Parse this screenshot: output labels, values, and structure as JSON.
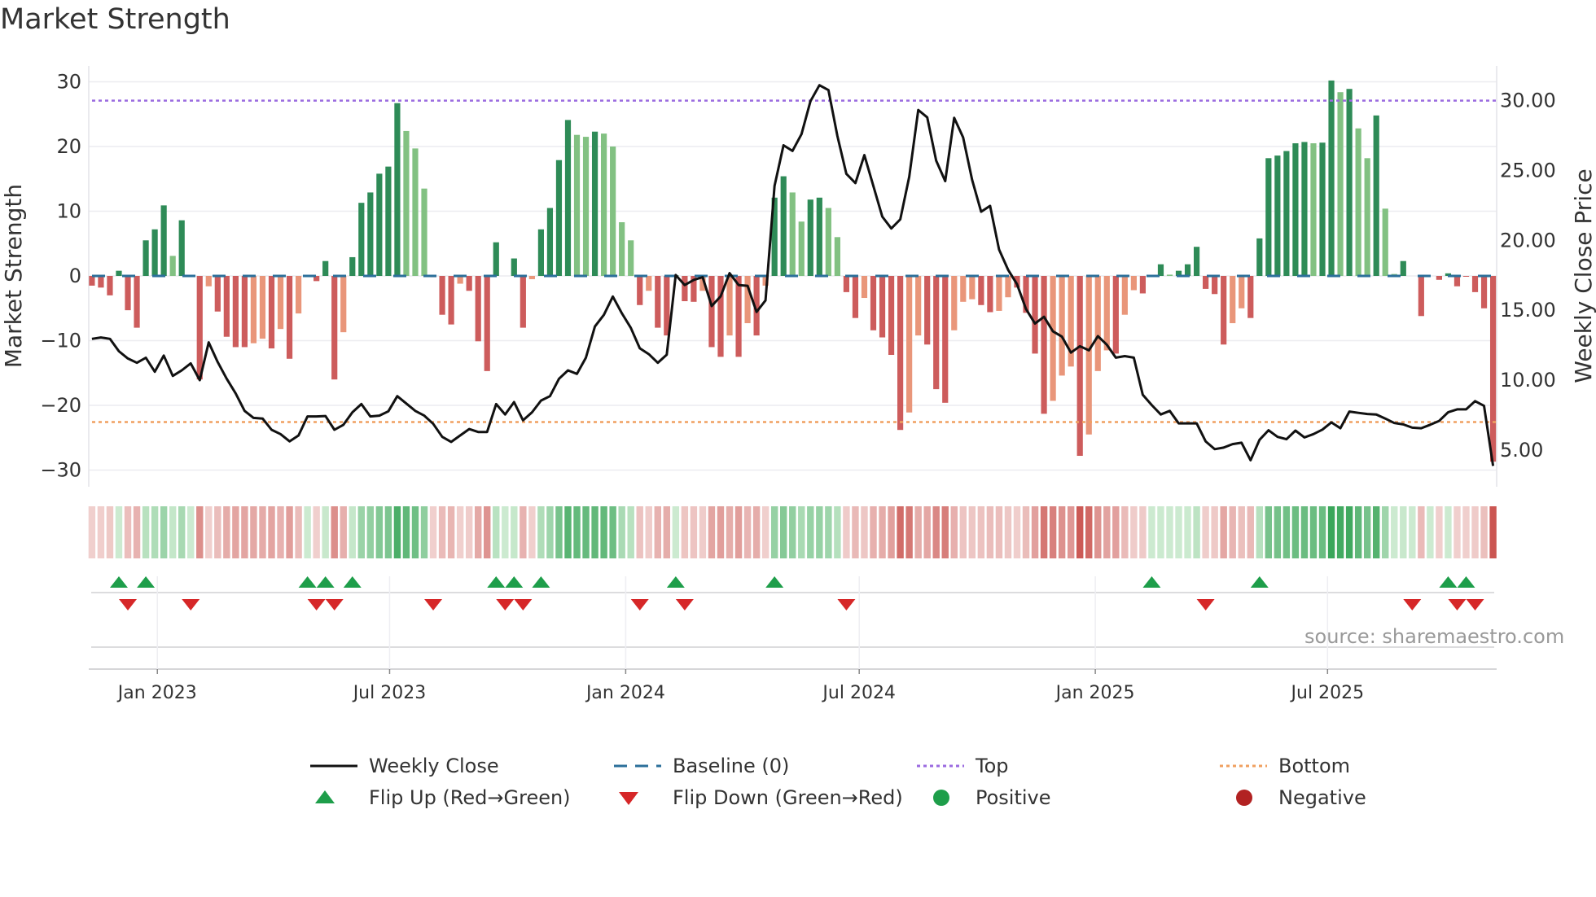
{
  "title": "Market Strength",
  "source": "source: sharemaestro.com",
  "legend": {
    "weekly_close": "Weekly Close",
    "baseline": "Baseline (0)",
    "top": "Top",
    "bottom": "Bottom",
    "flip_up": "Flip Up (Red→Green)",
    "flip_down": "Flip Down (Green→Red)",
    "positive": "Positive",
    "negative": "Negative"
  },
  "colors": {
    "strong_positive": "#2e8b57",
    "weak_positive": "#82c182",
    "strong_negative": "#cd5c5c",
    "weak_negative": "#e9967a",
    "baseline": "#2b6f9a",
    "top": "#9b6be0",
    "bottom": "#f0a060",
    "close": "#111111",
    "flip_up": "#1e9e4a",
    "flip_down": "#d62728",
    "positive": "#1e9e4a",
    "negative": "#b22222"
  },
  "chart_data": {
    "type": "bar+line",
    "title": "Market Strength",
    "start_week": "2022-11-11",
    "y_left": {
      "label": "Market Strength",
      "range": [
        -32.6,
        32.5
      ],
      "ticks": [
        30,
        20,
        10,
        0,
        -10,
        -20,
        -30
      ],
      "tick_labels": [
        "30",
        "20",
        "10",
        "0",
        "−10",
        "−20",
        "−30"
      ]
    },
    "y_right": {
      "label": "Weekly Close Price",
      "ticks": [
        30,
        25,
        20,
        15,
        10,
        5
      ],
      "tick_labels": [
        "30.00",
        "25.00",
        "20.00",
        "15.00",
        "10.00",
        "5.00"
      ]
    },
    "x_ticks": [
      {
        "label": "Jan 2023",
        "date": "2023-01-01"
      },
      {
        "label": "Jul 2023",
        "date": "2023-07-01"
      },
      {
        "label": "Jan 2024",
        "date": "2024-01-01"
      },
      {
        "label": "Jul 2024",
        "date": "2024-07-01"
      },
      {
        "label": "Jan 2025",
        "date": "2025-01-01"
      },
      {
        "label": "Jul 2025",
        "date": "2025-07-01"
      }
    ],
    "top_level_price": 30,
    "bottom_level_price": 7,
    "strength": [
      -1.5,
      -1.8,
      -3,
      0.8,
      -5.3,
      -8,
      5.5,
      7.2,
      10.9,
      3.1,
      8.6,
      0,
      -16,
      -1.6,
      -5.5,
      -9.4,
      -11,
      -11,
      -10.4,
      -9.7,
      -11.2,
      -8.2,
      -12.8,
      -5.8,
      0,
      -0.8,
      2.3,
      -16,
      -8.7,
      2.9,
      11.3,
      12.9,
      15.8,
      16.9,
      26.7,
      22.4,
      19.7,
      13.5,
      -0.2,
      -6,
      -7.5,
      -1.2,
      -2.3,
      -10.1,
      -14.7,
      5.2,
      0,
      2.7,
      -8,
      -0.5,
      7.2,
      10.5,
      17.9,
      24.1,
      21.8,
      21.5,
      22.3,
      22,
      20,
      8.3,
      5.5,
      -4.5,
      -2.3,
      -8,
      -9.2,
      0.1,
      -3.9,
      -4,
      -2.3,
      -11,
      -12.5,
      -9.2,
      -12.5,
      -7.3,
      -9.2,
      -1.5,
      12.1,
      15.4,
      12.9,
      8.4,
      11.8,
      12.1,
      10.5,
      6,
      -2.5,
      -6.5,
      -3.4,
      -8.4,
      -9.5,
      -12.2,
      -23.8,
      -21.1,
      -9.2,
      -10.6,
      -17.5,
      -19.6,
      -8.4,
      -4,
      -3.6,
      -4.5,
      -5.6,
      -5.4,
      -3.3,
      -1.8,
      -5.7,
      -12,
      -21.3,
      -19.3,
      -15.4,
      -14,
      -27.8,
      -24.5,
      -14.7,
      -11.5,
      -12,
      -6,
      -2.2,
      -2.7,
      0,
      1.8,
      0.2,
      0.8,
      1.8,
      4.5,
      -2,
      -2.8,
      -10.6,
      -7.3,
      -5,
      -6.5,
      5.8,
      18.2,
      18.6,
      19.3,
      20.5,
      20.7,
      20.5,
      20.6,
      30.2,
      28.4,
      28.9,
      22.8,
      18.2,
      24.8,
      10.4,
      0.3,
      2.3,
      0,
      -6.2,
      0,
      -0.6,
      0.4,
      -1.6,
      -0.1,
      -2.5,
      -5,
      -28.7
    ],
    "weakening_weeks": [
      9,
      13,
      18,
      19,
      21,
      23,
      28,
      35,
      36,
      37,
      41,
      49,
      54,
      55,
      57,
      58,
      59,
      60,
      62,
      68,
      71,
      73,
      75,
      78,
      79,
      82,
      83,
      86,
      91,
      92,
      96,
      97,
      98,
      101,
      102,
      107,
      108,
      109,
      111,
      112,
      113,
      115,
      116,
      120,
      127,
      128,
      136,
      139,
      141,
      142,
      144,
      145
    ],
    "close": [
      12.95,
      13.05,
      12.95,
      12.07,
      11.55,
      11.24,
      11.6,
      10.6,
      11.76,
      10.3,
      10.7,
      11.2,
      10.0,
      12.7,
      11.3,
      10.1,
      9.05,
      7.8,
      7.3,
      7.25,
      6.45,
      6.14,
      5.62,
      6.04,
      7.4,
      7.4,
      7.43,
      6.45,
      6.8,
      7.7,
      8.29,
      7.4,
      7.46,
      7.77,
      8.85,
      8.33,
      7.8,
      7.46,
      6.87,
      5.94,
      5.58,
      6.04,
      6.5,
      6.29,
      6.29,
      8.29,
      7.54,
      8.43,
      7.12,
      7.7,
      8.54,
      8.85,
      10.1,
      10.7,
      10.45,
      11.6,
      13.84,
      14.67,
      15.98,
      14.78,
      13.74,
      12.28,
      11.86,
      11.24,
      11.82,
      17.52,
      16.8,
      17.17,
      17.37,
      15.3,
      16.0,
      17.65,
      16.8,
      16.75,
      14.88,
      15.7,
      23.9,
      26.8,
      26.4,
      27.6,
      29.96,
      31.1,
      30.75,
      27.46,
      24.76,
      24.1,
      26.1,
      23.9,
      21.7,
      20.85,
      21.5,
      24.55,
      29.33,
      28.8,
      25.7,
      24.24,
      28.77,
      27.36,
      24.34,
      22.05,
      22.47,
      19.35,
      17.9,
      16.86,
      15.09,
      14.05,
      14.53,
      13.49,
      13.11,
      11.97,
      12.43,
      12.13,
      13.15,
      12.53,
      11.61,
      11.72,
      11.61,
      8.95,
      8.22,
      7.54,
      7.8,
      6.91,
      6.91,
      6.91,
      5.62,
      5.06,
      5.17,
      5.42,
      5.52,
      4.27,
      5.73,
      6.41,
      5.94,
      5.77,
      6.39,
      5.9,
      6.14,
      6.46,
      6.98,
      6.56,
      7.75,
      7.66,
      7.58,
      7.54,
      7.25,
      6.93,
      6.83,
      6.6,
      6.56,
      6.81,
      7.08,
      7.7,
      7.91,
      7.91,
      8.5,
      8.16,
      3.86
    ],
    "flip_up_weeks": [
      3,
      6,
      24,
      26,
      29,
      45,
      47,
      50,
      65,
      76,
      118,
      130,
      151,
      153
    ],
    "flip_down_weeks": [
      4,
      11,
      25,
      27,
      38,
      46,
      48,
      61,
      66,
      84,
      124,
      147,
      152,
      154
    ],
    "legend_position": "bottom"
  }
}
